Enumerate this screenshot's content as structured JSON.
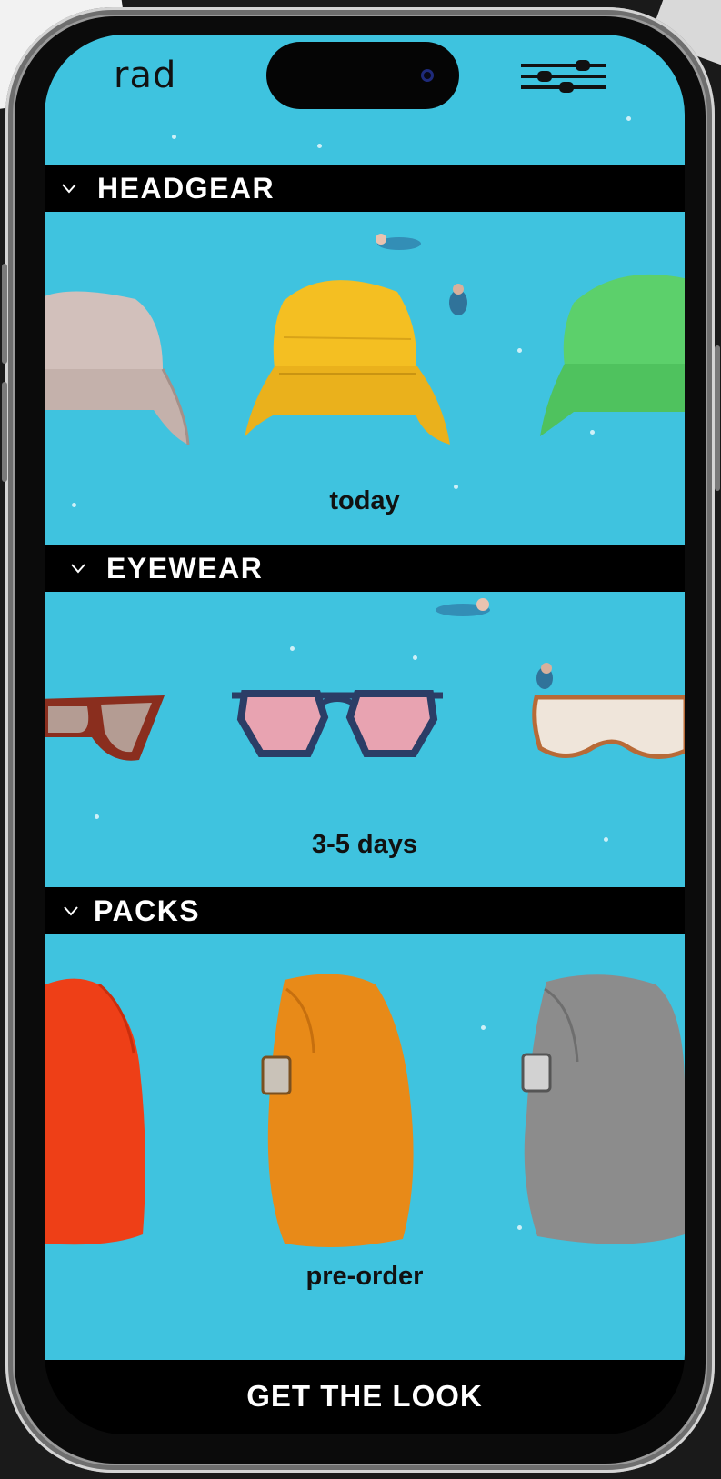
{
  "app": {
    "logo": "rad"
  },
  "sections": [
    {
      "title": "HEADGEAR",
      "availability": "today",
      "items": [
        {
          "name": "beige-bucket-hat",
          "color": "#d4c2bd"
        },
        {
          "name": "yellow-bucket-hat",
          "color": "#f5bf25"
        },
        {
          "name": "green-bucket-hat",
          "color": "#5ccf6a"
        }
      ]
    },
    {
      "title": "EYEWEAR",
      "availability": "3-5 days",
      "items": [
        {
          "name": "tortoise-cat-eye-sunglasses",
          "color": "#8a2e1e"
        },
        {
          "name": "pink-lens-sunglasses",
          "color": "#e8a4b2"
        },
        {
          "name": "shield-visor-sunglasses",
          "color": "#efe6dc"
        }
      ]
    },
    {
      "title": "PACKS",
      "availability": "pre-order",
      "items": [
        {
          "name": "red-backpack",
          "color": "#ee3f17"
        },
        {
          "name": "orange-backpack",
          "color": "#e88a18"
        },
        {
          "name": "grey-backpack",
          "color": "#8c8c8c"
        }
      ]
    }
  ],
  "cta": {
    "label": "GET THE LOOK"
  },
  "colors": {
    "water": "#3fc3df",
    "bar": "#000000"
  }
}
